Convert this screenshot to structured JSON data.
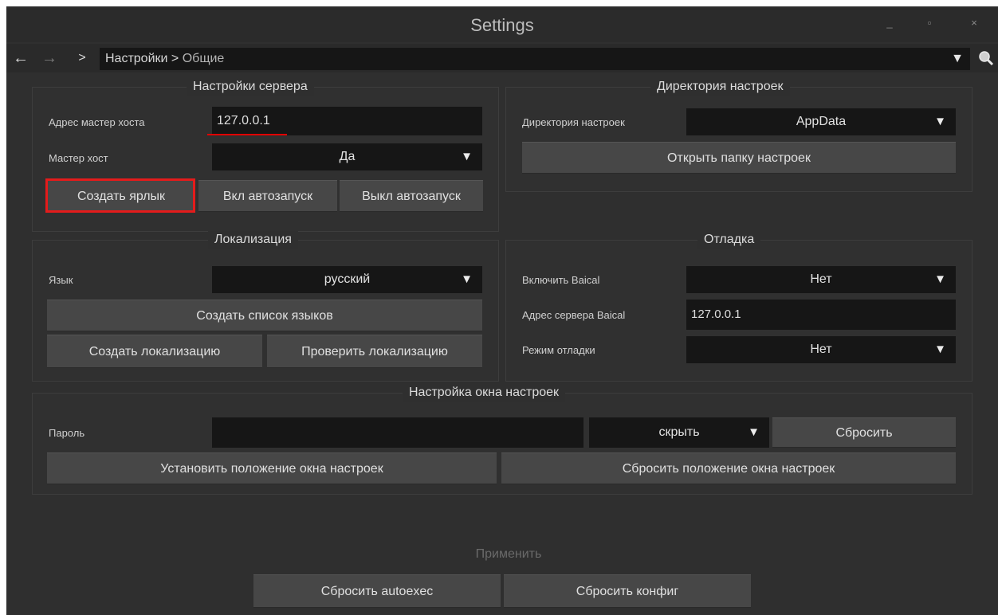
{
  "window": {
    "title": "Settings",
    "controls": [
      "_",
      "▫",
      "×"
    ]
  },
  "nav": {
    "back_glyph": "←",
    "forward_glyph": "→",
    "expand_glyph": ">",
    "breadcrumb_root": "Настройки",
    "breadcrumb_separator": ">",
    "breadcrumb_current": "Общие",
    "dropdown_glyph": "▼"
  },
  "server": {
    "title": "Настройки сервера",
    "host_label": "Адрес мастер хоста",
    "host_value": "127.0.0.1",
    "master_label": "Мастер хост",
    "master_value": "Да",
    "shortcut_button": "Создать ярлык",
    "autostart_on_button": "Вкл автозапуск",
    "autostart_off_button": "Выкл автозапуск"
  },
  "settings_dir": {
    "title": "Директория настроек",
    "dir_label": "Директория настроек",
    "dir_value": "AppData",
    "open_button": "Открыть папку настроек"
  },
  "localization": {
    "title": "Локализация",
    "lang_label": "Язык",
    "lang_value": "русский",
    "create_list_button": "Создать список языков",
    "create_loc_button": "Создать локализацию",
    "check_loc_button": "Проверить локализацию"
  },
  "debug": {
    "title": "Отладка",
    "baical_label": "Включить Baical",
    "baical_value": "Нет",
    "baical_addr_label": "Адрес сервера Baical",
    "baical_addr_value": "127.0.0.1",
    "debug_mode_label": "Режим отладки",
    "debug_mode_value": "Нет"
  },
  "window_settings": {
    "title": "Настройка окна настроек",
    "password_label": "Пароль",
    "password_value": "",
    "visibility_value": "скрыть",
    "reset_button": "Сбросить",
    "set_position_button": "Установить положение окна настроек",
    "reset_position_button": "Сбросить положение окна настроек"
  },
  "footer": {
    "apply_label": "Применить",
    "reset_autoexec_button": "Сбросить autoexec",
    "reset_config_button": "Сбросить конфиг"
  },
  "colors": {
    "background": "#2f2f2f",
    "field": "#161616",
    "button": "#474747",
    "highlight": "#e41b1b"
  }
}
